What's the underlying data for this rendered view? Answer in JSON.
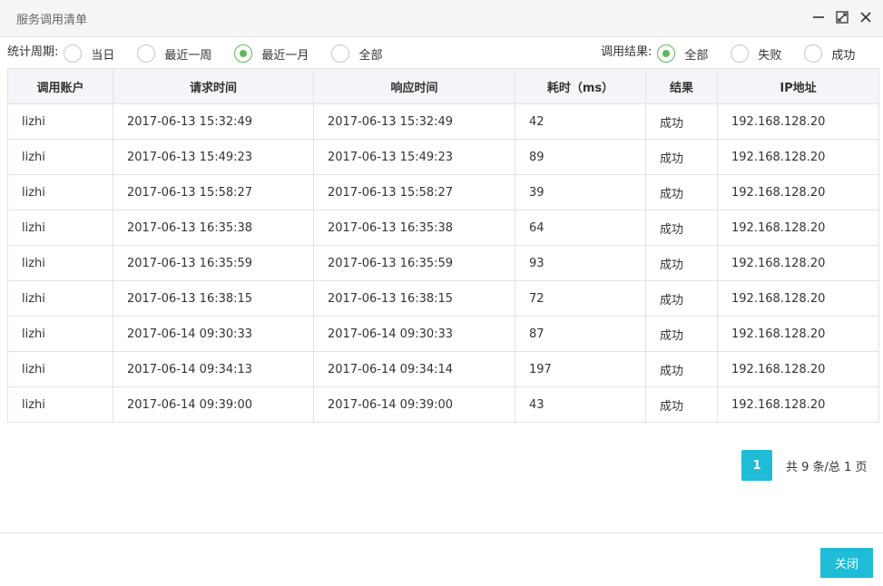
{
  "window": {
    "title": "服务调用清单",
    "minimize_icon": "minimize-icon",
    "maximize_icon": "maximize-icon",
    "close_icon": "close-icon"
  },
  "filters": {
    "period": {
      "label": "统计周期:",
      "options": [
        {
          "label": "当日",
          "checked": false
        },
        {
          "label": "最近一周",
          "checked": false
        },
        {
          "label": "最近一月",
          "checked": true
        },
        {
          "label": "全部",
          "checked": false
        }
      ]
    },
    "result": {
      "label": "调用结果:",
      "options": [
        {
          "label": "全部",
          "checked": true
        },
        {
          "label": "失败",
          "checked": false
        },
        {
          "label": "成功",
          "checked": false
        }
      ]
    }
  },
  "table": {
    "columns": [
      "调用账户",
      "请求时间",
      "响应时间",
      "耗时（ms）",
      "结果",
      "IP地址"
    ],
    "rows": [
      [
        "lizhi",
        "2017-06-13 15:32:49",
        "2017-06-13 15:32:49",
        "42",
        "成功",
        "192.168.128.20"
      ],
      [
        "lizhi",
        "2017-06-13 15:49:23",
        "2017-06-13 15:49:23",
        "89",
        "成功",
        "192.168.128.20"
      ],
      [
        "lizhi",
        "2017-06-13 15:58:27",
        "2017-06-13 15:58:27",
        "39",
        "成功",
        "192.168.128.20"
      ],
      [
        "lizhi",
        "2017-06-13 16:35:38",
        "2017-06-13 16:35:38",
        "64",
        "成功",
        "192.168.128.20"
      ],
      [
        "lizhi",
        "2017-06-13 16:35:59",
        "2017-06-13 16:35:59",
        "93",
        "成功",
        "192.168.128.20"
      ],
      [
        "lizhi",
        "2017-06-13 16:38:15",
        "2017-06-13 16:38:15",
        "72",
        "成功",
        "192.168.128.20"
      ],
      [
        "lizhi",
        "2017-06-14 09:30:33",
        "2017-06-14 09:30:33",
        "87",
        "成功",
        "192.168.128.20"
      ],
      [
        "lizhi",
        "2017-06-14 09:34:13",
        "2017-06-14 09:34:14",
        "197",
        "成功",
        "192.168.128.20"
      ],
      [
        "lizhi",
        "2017-06-14 09:39:00",
        "2017-06-14 09:39:00",
        "43",
        "成功",
        "192.168.128.20"
      ]
    ]
  },
  "pagination": {
    "current_page": "1",
    "info": "共 9 条/总 1 页"
  },
  "footer": {
    "close_label": "关闭"
  },
  "colors": {
    "accent": "#1ebcd7",
    "radio_checked": "#5cb85c",
    "header_bg": "#f4f5f8",
    "titlebar_bg": "#f5f5f7"
  }
}
